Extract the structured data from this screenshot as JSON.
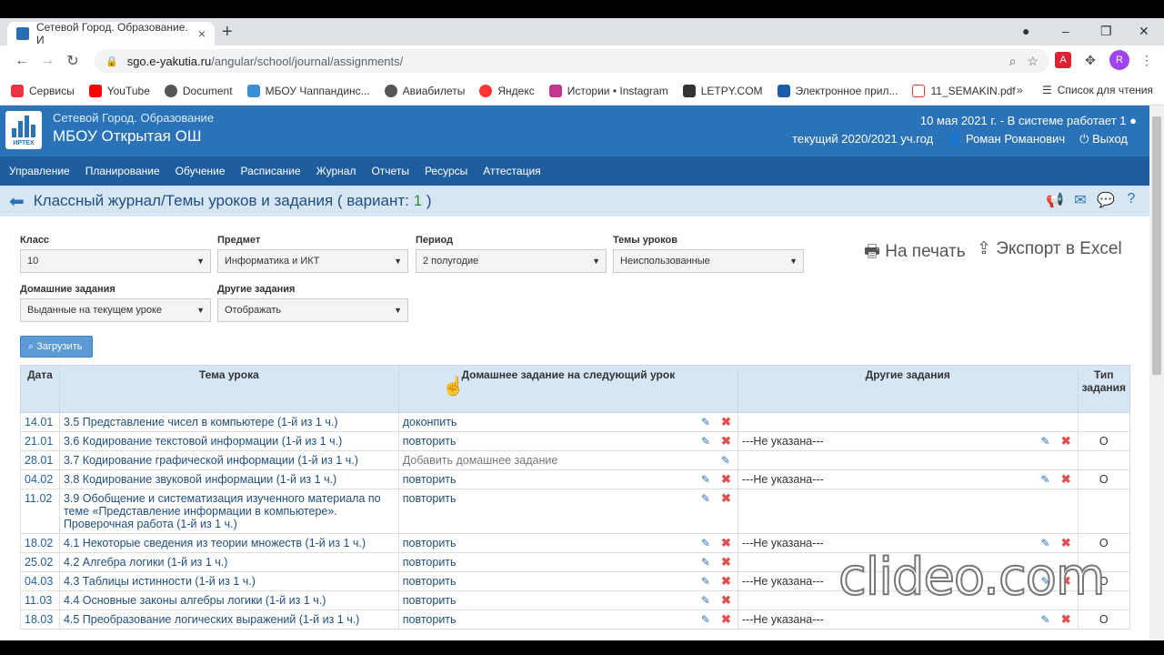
{
  "browser": {
    "tab_title": "Сетевой Город. Образование. И",
    "url_domain": "sgo.e-yakutia.ru",
    "url_path": "/angular/school/journal/assignments/"
  },
  "bookmarks": [
    "Сервисы",
    "YouTube",
    "Document",
    "МБОУ Чаппандинс...",
    "Авиабилеты",
    "Яндекс",
    "Истории • Instagram",
    "LETPY.COM",
    "Электронное прил...",
    "11_SEMAKIN.pdf"
  ],
  "reading_list": "Список для чтения",
  "header": {
    "system": "Сетевой Город. Образование",
    "school": "МБОУ Открытая ОШ",
    "status": "10 мая 2021 г. - В системе работает 1",
    "year": "текущий 2020/2021 уч.год",
    "user": "Роман Романович",
    "logout": "Выход",
    "logo_text": "ИРТЕХ"
  },
  "menu": [
    "Управление",
    "Планирование",
    "Обучение",
    "Расписание",
    "Журнал",
    "Отчеты",
    "Ресурсы",
    "Аттестация"
  ],
  "title": {
    "text": "Классный журнал/Темы уроков и задания ( вариант: ",
    "variant": "1",
    "close": " )"
  },
  "filters": {
    "class_label": "Класс",
    "class_value": "10",
    "subject_label": "Предмет",
    "subject_value": "Информатика и ИКТ",
    "period_label": "Период",
    "period_value": "2 полугодие",
    "topics_label": "Темы уроков",
    "topics_value": "Неиспользованные",
    "hw_label": "Домашние задания",
    "hw_value": "Выданные на текущем уроке",
    "other_label": "Другие задания",
    "other_value": "Отображать",
    "load": "Загрузить",
    "print": "На печать",
    "export": "Экспорт в Excel"
  },
  "table": {
    "headers": [
      "Дата",
      "Тема урока",
      "Домашнее задание на следующий урок",
      "Другие задания",
      "Тип задания"
    ],
    "rows": [
      {
        "date": "14.01",
        "topic": "3.5 Представление чисел в компьютере (1-й из 1 ч.)",
        "hw": "доконпить",
        "other": "",
        "type": ""
      },
      {
        "date": "21.01",
        "topic": "3.6 Кодирование текстовой информации (1-й из 1 ч.)",
        "hw": "повторить",
        "other": "---Не указана---",
        "type": "О"
      },
      {
        "date": "28.01",
        "topic": "3.7 Кодирование графической информации (1-й из 1 ч.)",
        "hw": "Добавить домашнее задание",
        "other": "",
        "type": ""
      },
      {
        "date": "04.02",
        "topic": "3.8 Кодирование звуковой информации (1-й из 1 ч.)",
        "hw": "повторить",
        "other": "---Не указана---",
        "type": "О"
      },
      {
        "date": "11.02",
        "topic": "3.9 Обобщение и систематизация изученного материала по теме «Представление информации в компьютере». Проверочная работа (1-й из 1 ч.)",
        "hw": "повторить",
        "other": "",
        "type": ""
      },
      {
        "date": "18.02",
        "topic": "4.1 Некоторые сведения из теории множеств (1-й из 1 ч.)",
        "hw": "повторить",
        "other": "---Не указана---",
        "type": "О"
      },
      {
        "date": "25.02",
        "topic": "4.2 Алгебра логики (1-й из 1 ч.)",
        "hw": "повторить",
        "other": "",
        "type": ""
      },
      {
        "date": "04.03",
        "topic": "4.3 Таблицы истинности (1-й из 1 ч.)",
        "hw": "повторить",
        "other": "---Не указана---",
        "type": "О"
      },
      {
        "date": "11.03",
        "topic": "4.4 Основные законы алгебры логики (1-й из 1 ч.)",
        "hw": "повторить",
        "other": "",
        "type": ""
      },
      {
        "date": "18.03",
        "topic": "4.5 Преобразование логических выражений (1-й из 1 ч.)",
        "hw": "повторить",
        "other": "---Не указана---",
        "type": "О"
      }
    ]
  },
  "watermark": "clideo.com"
}
